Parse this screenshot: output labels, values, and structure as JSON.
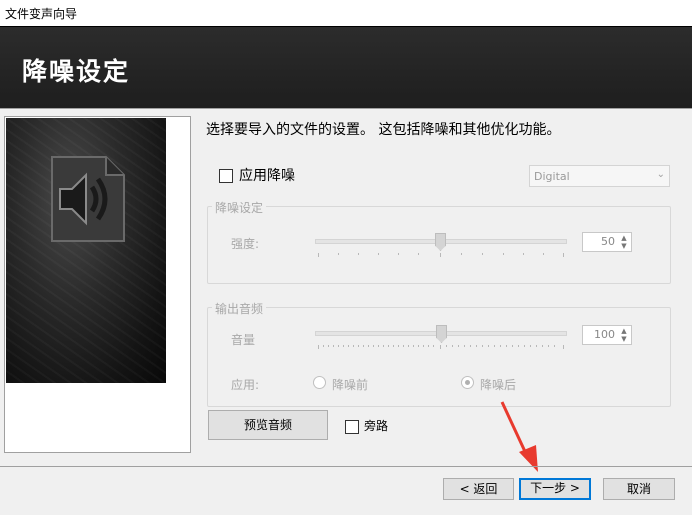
{
  "window": {
    "title": "文件变声向导"
  },
  "header": {
    "title": "降噪设定"
  },
  "main": {
    "description": "选择要导入的文件的设置。 这包括降噪和其他优化功能。",
    "apply_noise_reduction": {
      "label": "应用降噪",
      "checked": false
    },
    "mode_select": {
      "value": "Digital"
    },
    "noise_group": {
      "title": "降噪设定",
      "strength_label": "强度:",
      "strength_value": "50",
      "strength_level": 50
    },
    "output_group": {
      "title": "输出音频",
      "volume_label": "音量",
      "volume_value": "100",
      "apply_label": "应用:",
      "options": [
        "降噪前",
        "降噪后"
      ],
      "selected": "降噪后"
    },
    "preview_button": "预览音频",
    "bypass": {
      "label": "旁路",
      "checked": false
    }
  },
  "footer": {
    "back": "< 返回",
    "next": "下一步 >",
    "cancel": "取消"
  },
  "icons": {
    "left_icon": "speaker-icon",
    "annotation": "red-arrow-icon"
  },
  "colors": {
    "header_bg": "#222222",
    "arrow": "#e83a2e"
  }
}
